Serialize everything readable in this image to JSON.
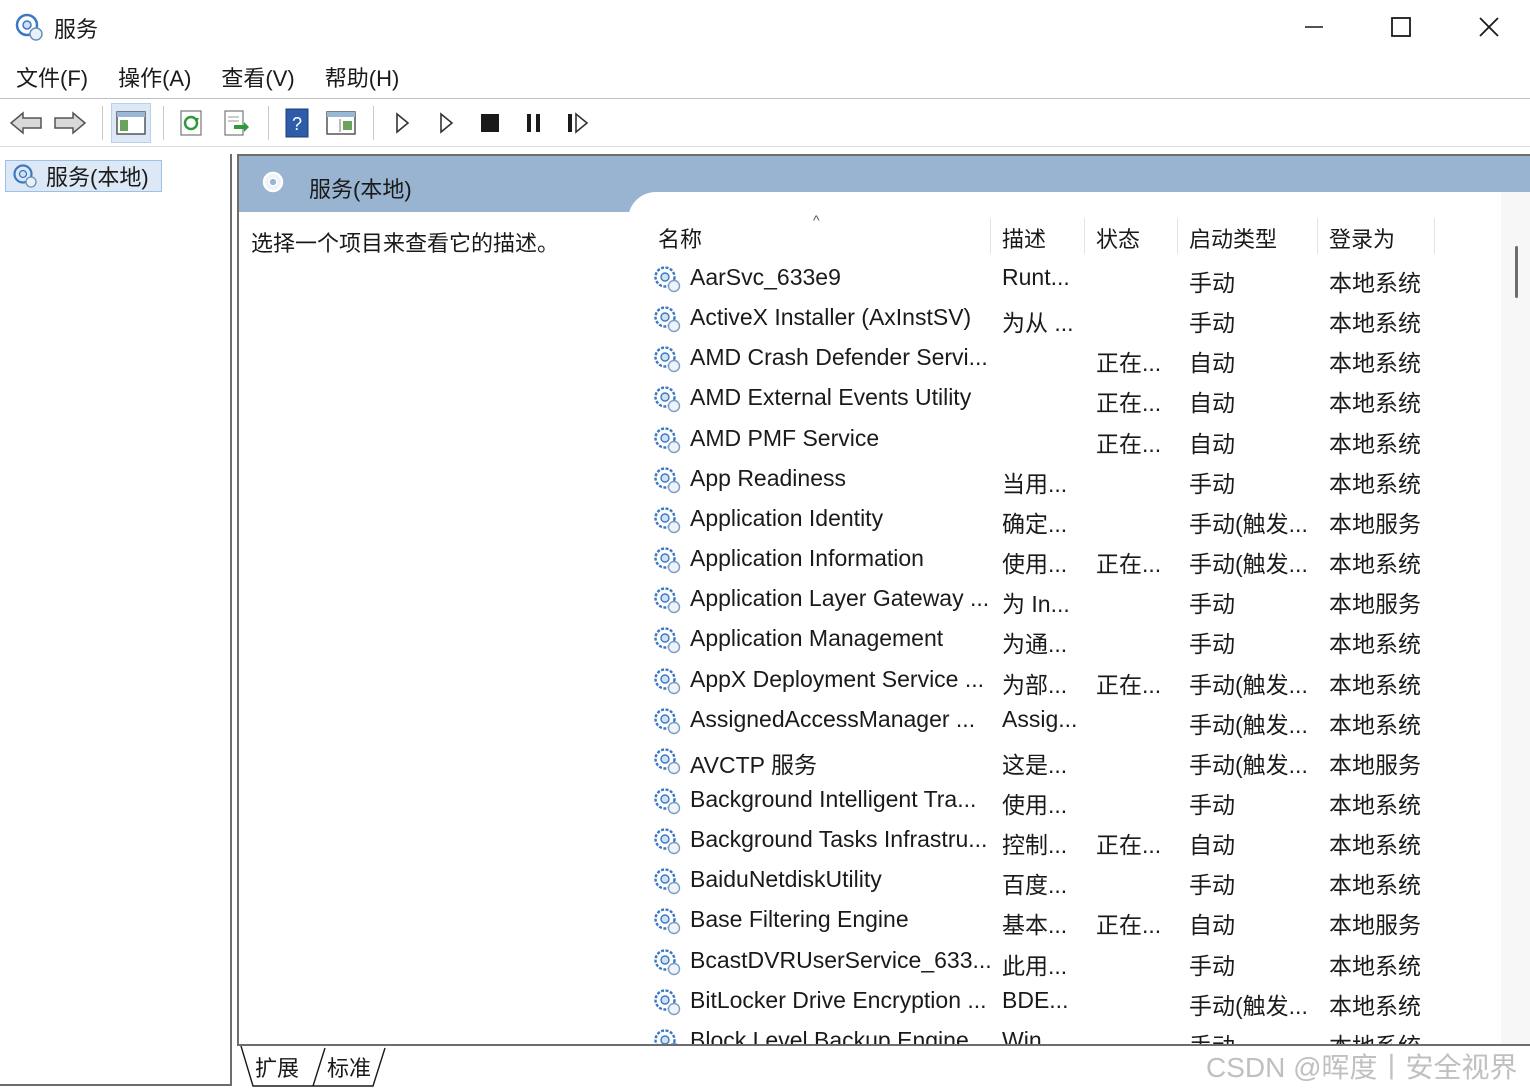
{
  "window": {
    "title": "服务",
    "icon": "services-gear-icon",
    "controls": [
      "minimize",
      "maximize",
      "close"
    ]
  },
  "menu": {
    "items": [
      "文件(F)",
      "操作(A)",
      "查看(V)",
      "帮助(H)"
    ]
  },
  "toolbar": {
    "buttons": [
      "back",
      "forward",
      "show-hide-console-tree",
      "refresh",
      "export-list",
      "help",
      "properties",
      "start",
      "start-alt",
      "stop",
      "pause",
      "resume"
    ]
  },
  "tree": {
    "selected_label": "服务(本地)"
  },
  "pane": {
    "title": "服务(本地)",
    "description_prompt": "选择一个项目来查看它的描述。"
  },
  "table": {
    "columns": [
      "名称",
      "描述",
      "状态",
      "启动类型",
      "登录为"
    ],
    "sort_indicator": "^",
    "rows": [
      {
        "name": "AarSvc_633e9",
        "desc": "Runt...",
        "status": "",
        "startup": "手动",
        "logon": "本地系统"
      },
      {
        "name": "ActiveX Installer (AxInstSV)",
        "desc": "为从 ...",
        "status": "",
        "startup": "手动",
        "logon": "本地系统"
      },
      {
        "name": "AMD Crash Defender Servi...",
        "desc": "",
        "status": "正在...",
        "startup": "自动",
        "logon": "本地系统"
      },
      {
        "name": "AMD External Events Utility",
        "desc": "",
        "status": "正在...",
        "startup": "自动",
        "logon": "本地系统"
      },
      {
        "name": "AMD PMF Service",
        "desc": "",
        "status": "正在...",
        "startup": "自动",
        "logon": "本地系统"
      },
      {
        "name": "App Readiness",
        "desc": "当用...",
        "status": "",
        "startup": "手动",
        "logon": "本地系统"
      },
      {
        "name": "Application Identity",
        "desc": "确定...",
        "status": "",
        "startup": "手动(触发...",
        "logon": "本地服务"
      },
      {
        "name": "Application Information",
        "desc": "使用...",
        "status": "正在...",
        "startup": "手动(触发...",
        "logon": "本地系统"
      },
      {
        "name": "Application Layer Gateway ...",
        "desc": "为 In...",
        "status": "",
        "startup": "手动",
        "logon": "本地服务"
      },
      {
        "name": "Application Management",
        "desc": "为通...",
        "status": "",
        "startup": "手动",
        "logon": "本地系统"
      },
      {
        "name": "AppX Deployment Service ...",
        "desc": "为部...",
        "status": "正在...",
        "startup": "手动(触发...",
        "logon": "本地系统"
      },
      {
        "name": "AssignedAccessManager ...",
        "desc": "Assig...",
        "status": "",
        "startup": "手动(触发...",
        "logon": "本地系统"
      },
      {
        "name": "AVCTP 服务",
        "desc": "这是...",
        "status": "",
        "startup": "手动(触发...",
        "logon": "本地服务"
      },
      {
        "name": "Background Intelligent Tra...",
        "desc": "使用...",
        "status": "",
        "startup": "手动",
        "logon": "本地系统"
      },
      {
        "name": "Background Tasks Infrastru...",
        "desc": "控制...",
        "status": "正在...",
        "startup": "自动",
        "logon": "本地系统"
      },
      {
        "name": "BaiduNetdiskUtility",
        "desc": "百度...",
        "status": "",
        "startup": "手动",
        "logon": "本地系统"
      },
      {
        "name": "Base Filtering Engine",
        "desc": "基本...",
        "status": "正在...",
        "startup": "自动",
        "logon": "本地服务"
      },
      {
        "name": "BcastDVRUserService_633...",
        "desc": "此用...",
        "status": "",
        "startup": "手动",
        "logon": "本地系统"
      },
      {
        "name": "BitLocker Drive Encryption ...",
        "desc": "BDE...",
        "status": "",
        "startup": "手动(触发...",
        "logon": "本地系统"
      },
      {
        "name": "Block Level Backup Engine ...",
        "desc": "Win...",
        "status": "",
        "startup": "手动",
        "logon": "本地系统"
      }
    ]
  },
  "tabs": [
    "扩展",
    "标准"
  ],
  "watermark": "CSDN @晖度丨安全视界",
  "colors": {
    "header_band": "#99b4d1",
    "selection": "#dce8f5",
    "icon_blue": "#3a78c2"
  }
}
